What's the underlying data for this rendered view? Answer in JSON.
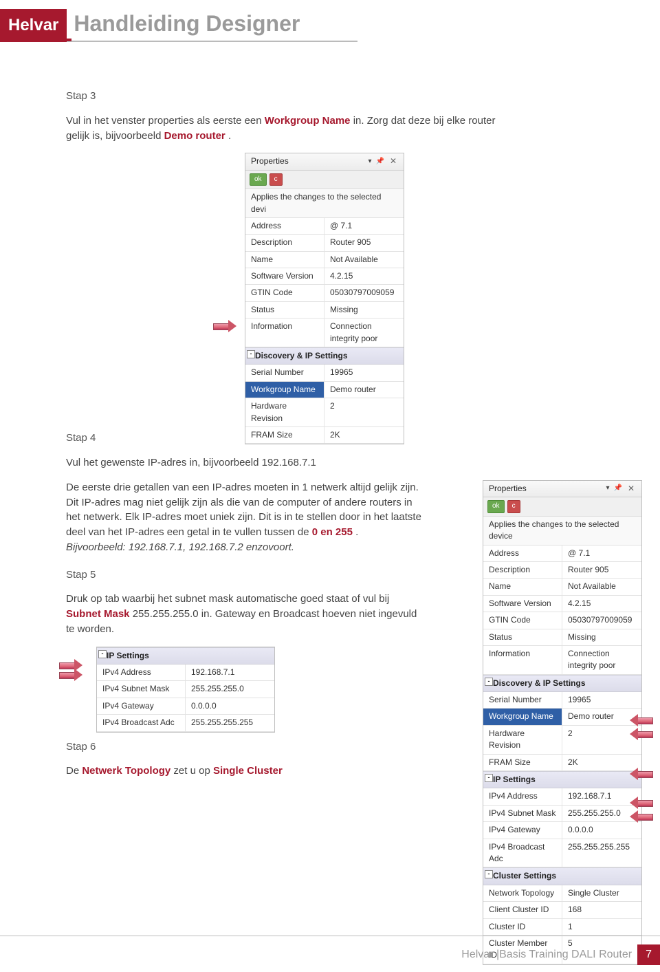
{
  "brand": "Helvar",
  "doc_title": "Handleiding Designer",
  "step3": {
    "label": "Stap 3",
    "p1a": "Vul in het venster properties als eerste een ",
    "p1b_bold": "Workgroup Name",
    "p1c": " in. Zorg dat deze bij elke router gelijk is, bijvoorbeeld ",
    "p1d_bold": "Demo router",
    "p1e": "."
  },
  "panel_common": {
    "title": "Properties",
    "ok": "ok",
    "c": "c",
    "applies": "Applies the changes to the selected devi",
    "applies_long": "Applies the changes to the selected device",
    "rows_general": [
      {
        "k": "Address",
        "v": "@ 7.1"
      },
      {
        "k": "Description",
        "v": "Router 905"
      },
      {
        "k": "Name",
        "v": "Not Available"
      },
      {
        "k": "Software Version",
        "v": "4.2.15"
      },
      {
        "k": "GTIN Code",
        "v": "05030797009059"
      },
      {
        "k": "Status",
        "v": "Missing"
      },
      {
        "k": "Information",
        "v": "Connection integrity poor"
      }
    ],
    "section_discovery": "Discovery & IP Settings",
    "rows_discovery": [
      {
        "k": "Serial Number",
        "v": "19965"
      },
      {
        "k": "Workgroup Name",
        "v": "Demo router",
        "sel": true
      },
      {
        "k": "Hardware Revision",
        "v": "2"
      },
      {
        "k": "FRAM Size",
        "v": "2K"
      }
    ],
    "section_ip": "IP Settings",
    "rows_ip": [
      {
        "k": "IPv4 Address",
        "v": "192.168.7.1"
      },
      {
        "k": "IPv4 Subnet Mask",
        "v": "255.255.255.0"
      },
      {
        "k": "IPv4 Gateway",
        "v": "0.0.0.0"
      },
      {
        "k": "IPv4 Broadcast Adc",
        "v": "255.255.255.255"
      }
    ],
    "section_cluster": "Cluster Settings",
    "rows_cluster": [
      {
        "k": "Network Topology",
        "v": "Single Cluster"
      },
      {
        "k": "Client Cluster ID",
        "v": "168"
      },
      {
        "k": "Cluster ID",
        "v": "1"
      },
      {
        "k": "Cluster Member ID",
        "v": "5"
      }
    ]
  },
  "step4": {
    "label": "Stap 4",
    "p1": "Vul het gewenste IP-adres in, bijvoorbeeld 192.168.7.1",
    "p2a": "De eerste drie getallen van een IP-adres moeten in 1 netwerk altijd gelijk zijn. Dit IP-adres mag niet gelijk zijn als die van de computer of andere routers in het netwerk. Elk IP-adres moet uniek zijn. Dit is in te stellen door in het laatste deel van het IP-adres een getal in te vullen tussen de ",
    "p2b_bold": "0 en 255",
    "p2c": ".",
    "p3_italic": "Bijvoorbeeld: 192.168.7.1, 192.168.7.2 enzovoort."
  },
  "step5": {
    "label": "Stap 5",
    "p1a": "Druk op tab waarbij het subnet mask automatische goed staat of vul bij ",
    "p1b_bold": "Subnet Mask",
    "p1c": " 255.255.255.0 in. Gateway en Broadcast hoeven niet ingevuld te worden."
  },
  "step6": {
    "label": "Stap 6",
    "p1a": "De ",
    "p1b_bold": "Netwerk Topology",
    "p1c": " zet u op ",
    "p1d_bold": "Single Cluster"
  },
  "footer": {
    "text": "Helvar |Basis Training DALI Router",
    "page": "7"
  }
}
